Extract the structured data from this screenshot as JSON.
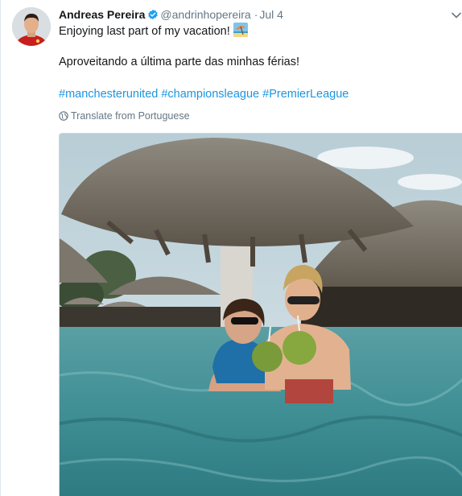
{
  "tweet": {
    "display_name": "Andreas Pereira",
    "handle": "@andrinhopereira",
    "separator": "·",
    "date": "Jul 4",
    "text_line1": "Enjoying last part of my vacation!",
    "text_line2": "Aproveitando a última parte das minhas férias!",
    "hashtags": [
      "#manchesterunited",
      "#championsleague",
      "#PremierLeague"
    ],
    "translate_label": "Translate from Portuguese"
  },
  "icons": {
    "verified": "verified-badge-icon",
    "emoji": "beach-with-umbrella-emoji",
    "caret": "chevron-down-icon",
    "globe": "globe-icon"
  },
  "colors": {
    "link": "#1b95e0",
    "secondary": "#657786",
    "verified": "#1da1f2",
    "water": "#3f8f95"
  }
}
